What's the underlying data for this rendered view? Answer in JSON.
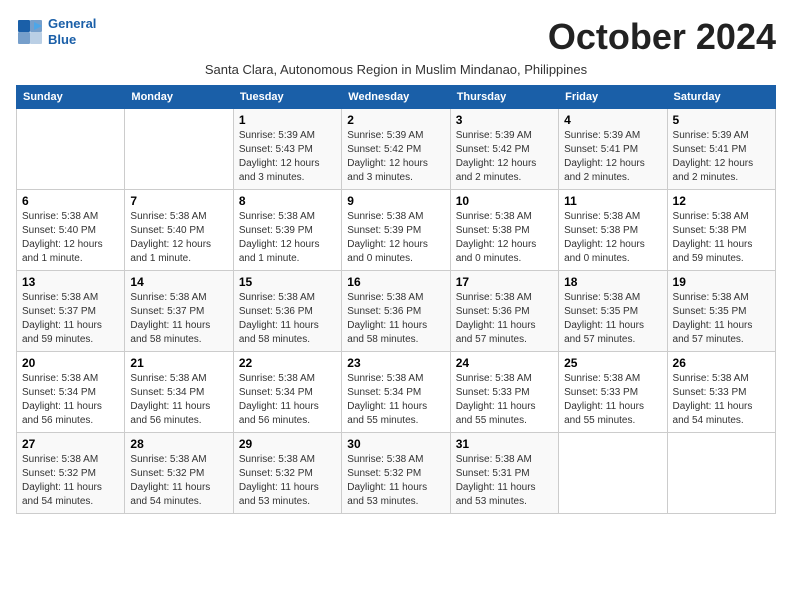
{
  "logo": {
    "line1": "General",
    "line2": "Blue"
  },
  "title": "October 2024",
  "subtitle": "Santa Clara, Autonomous Region in Muslim Mindanao, Philippines",
  "headers": [
    "Sunday",
    "Monday",
    "Tuesday",
    "Wednesday",
    "Thursday",
    "Friday",
    "Saturday"
  ],
  "weeks": [
    [
      {
        "date": "",
        "info": ""
      },
      {
        "date": "",
        "info": ""
      },
      {
        "date": "1",
        "info": "Sunrise: 5:39 AM\nSunset: 5:43 PM\nDaylight: 12 hours\nand 3 minutes."
      },
      {
        "date": "2",
        "info": "Sunrise: 5:39 AM\nSunset: 5:42 PM\nDaylight: 12 hours\nand 3 minutes."
      },
      {
        "date": "3",
        "info": "Sunrise: 5:39 AM\nSunset: 5:42 PM\nDaylight: 12 hours\nand 2 minutes."
      },
      {
        "date": "4",
        "info": "Sunrise: 5:39 AM\nSunset: 5:41 PM\nDaylight: 12 hours\nand 2 minutes."
      },
      {
        "date": "5",
        "info": "Sunrise: 5:39 AM\nSunset: 5:41 PM\nDaylight: 12 hours\nand 2 minutes."
      }
    ],
    [
      {
        "date": "6",
        "info": "Sunrise: 5:38 AM\nSunset: 5:40 PM\nDaylight: 12 hours\nand 1 minute."
      },
      {
        "date": "7",
        "info": "Sunrise: 5:38 AM\nSunset: 5:40 PM\nDaylight: 12 hours\nand 1 minute."
      },
      {
        "date": "8",
        "info": "Sunrise: 5:38 AM\nSunset: 5:39 PM\nDaylight: 12 hours\nand 1 minute."
      },
      {
        "date": "9",
        "info": "Sunrise: 5:38 AM\nSunset: 5:39 PM\nDaylight: 12 hours\nand 0 minutes."
      },
      {
        "date": "10",
        "info": "Sunrise: 5:38 AM\nSunset: 5:38 PM\nDaylight: 12 hours\nand 0 minutes."
      },
      {
        "date": "11",
        "info": "Sunrise: 5:38 AM\nSunset: 5:38 PM\nDaylight: 12 hours\nand 0 minutes."
      },
      {
        "date": "12",
        "info": "Sunrise: 5:38 AM\nSunset: 5:38 PM\nDaylight: 11 hours\nand 59 minutes."
      }
    ],
    [
      {
        "date": "13",
        "info": "Sunrise: 5:38 AM\nSunset: 5:37 PM\nDaylight: 11 hours\nand 59 minutes."
      },
      {
        "date": "14",
        "info": "Sunrise: 5:38 AM\nSunset: 5:37 PM\nDaylight: 11 hours\nand 58 minutes."
      },
      {
        "date": "15",
        "info": "Sunrise: 5:38 AM\nSunset: 5:36 PM\nDaylight: 11 hours\nand 58 minutes."
      },
      {
        "date": "16",
        "info": "Sunrise: 5:38 AM\nSunset: 5:36 PM\nDaylight: 11 hours\nand 58 minutes."
      },
      {
        "date": "17",
        "info": "Sunrise: 5:38 AM\nSunset: 5:36 PM\nDaylight: 11 hours\nand 57 minutes."
      },
      {
        "date": "18",
        "info": "Sunrise: 5:38 AM\nSunset: 5:35 PM\nDaylight: 11 hours\nand 57 minutes."
      },
      {
        "date": "19",
        "info": "Sunrise: 5:38 AM\nSunset: 5:35 PM\nDaylight: 11 hours\nand 57 minutes."
      }
    ],
    [
      {
        "date": "20",
        "info": "Sunrise: 5:38 AM\nSunset: 5:34 PM\nDaylight: 11 hours\nand 56 minutes."
      },
      {
        "date": "21",
        "info": "Sunrise: 5:38 AM\nSunset: 5:34 PM\nDaylight: 11 hours\nand 56 minutes."
      },
      {
        "date": "22",
        "info": "Sunrise: 5:38 AM\nSunset: 5:34 PM\nDaylight: 11 hours\nand 56 minutes."
      },
      {
        "date": "23",
        "info": "Sunrise: 5:38 AM\nSunset: 5:34 PM\nDaylight: 11 hours\nand 55 minutes."
      },
      {
        "date": "24",
        "info": "Sunrise: 5:38 AM\nSunset: 5:33 PM\nDaylight: 11 hours\nand 55 minutes."
      },
      {
        "date": "25",
        "info": "Sunrise: 5:38 AM\nSunset: 5:33 PM\nDaylight: 11 hours\nand 55 minutes."
      },
      {
        "date": "26",
        "info": "Sunrise: 5:38 AM\nSunset: 5:33 PM\nDaylight: 11 hours\nand 54 minutes."
      }
    ],
    [
      {
        "date": "27",
        "info": "Sunrise: 5:38 AM\nSunset: 5:32 PM\nDaylight: 11 hours\nand 54 minutes."
      },
      {
        "date": "28",
        "info": "Sunrise: 5:38 AM\nSunset: 5:32 PM\nDaylight: 11 hours\nand 54 minutes."
      },
      {
        "date": "29",
        "info": "Sunrise: 5:38 AM\nSunset: 5:32 PM\nDaylight: 11 hours\nand 53 minutes."
      },
      {
        "date": "30",
        "info": "Sunrise: 5:38 AM\nSunset: 5:32 PM\nDaylight: 11 hours\nand 53 minutes."
      },
      {
        "date": "31",
        "info": "Sunrise: 5:38 AM\nSunset: 5:31 PM\nDaylight: 11 hours\nand 53 minutes."
      },
      {
        "date": "",
        "info": ""
      },
      {
        "date": "",
        "info": ""
      }
    ]
  ]
}
